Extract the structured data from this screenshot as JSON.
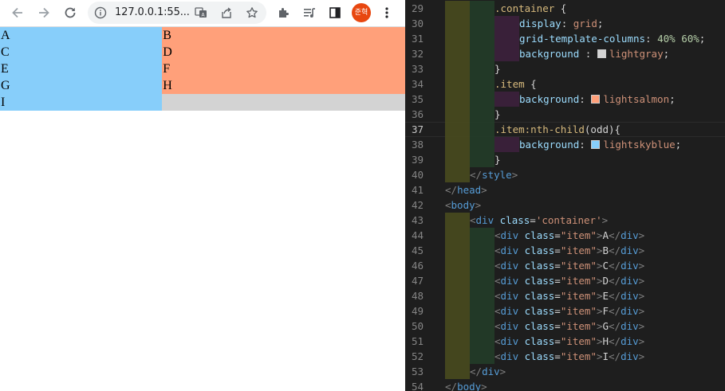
{
  "browser": {
    "url": "127.0.0.1:55...",
    "avatar_text": "준혁",
    "grid_items": [
      "A",
      "B",
      "C",
      "D",
      "E",
      "F",
      "G",
      "H",
      "I"
    ]
  },
  "editor": {
    "lines": [
      {
        "n": "29",
        "indent": 2,
        "text": ".container {",
        "kind": "selector"
      },
      {
        "n": "30",
        "indent": 3,
        "prop": "display",
        "val": "grid"
      },
      {
        "n": "31",
        "indent": 3,
        "prop": "grid-template-columns",
        "val": "40% 60%",
        "valkind": "num"
      },
      {
        "n": "32",
        "indent": 3,
        "prop": "background ",
        "val": "lightgray",
        "swatch": "#d3d3d3"
      },
      {
        "n": "33",
        "indent": 2,
        "text": "}",
        "kind": "punct"
      },
      {
        "n": "34",
        "indent": 2,
        "text": ".item {",
        "kind": "selector"
      },
      {
        "n": "35",
        "indent": 3,
        "prop": "background",
        "val": "lightsalmon",
        "swatch": "#ffa07a"
      },
      {
        "n": "36",
        "indent": 2,
        "text": "}",
        "kind": "punct"
      },
      {
        "n": "37",
        "indent": 2,
        "text": ".item:nth-child(odd){",
        "kind": "nth",
        "current": true
      },
      {
        "n": "38",
        "indent": 3,
        "prop": "background",
        "val": "lightskyblue",
        "swatch": "#87cefa"
      },
      {
        "n": "39",
        "indent": 2,
        "text": "}",
        "kind": "punct"
      },
      {
        "n": "40",
        "indent": 1,
        "tag": "/style"
      },
      {
        "n": "41",
        "indent": 0,
        "tag": "/head"
      },
      {
        "n": "42",
        "indent": 0,
        "tag": "body"
      },
      {
        "n": "43",
        "indent": 1,
        "tag": "div",
        "attr": "class",
        "attrval": "'container'"
      },
      {
        "n": "44",
        "indent": 2,
        "tag": "div",
        "attr": "class",
        "attrval": "\"item\"",
        "inner": "A"
      },
      {
        "n": "45",
        "indent": 2,
        "tag": "div",
        "attr": "class",
        "attrval": "\"item\"",
        "inner": "B"
      },
      {
        "n": "46",
        "indent": 2,
        "tag": "div",
        "attr": "class",
        "attrval": "\"item\"",
        "inner": "C"
      },
      {
        "n": "47",
        "indent": 2,
        "tag": "div",
        "attr": "class",
        "attrval": "\"item\"",
        "inner": "D"
      },
      {
        "n": "48",
        "indent": 2,
        "tag": "div",
        "attr": "class",
        "attrval": "\"item\"",
        "inner": "E"
      },
      {
        "n": "49",
        "indent": 2,
        "tag": "div",
        "attr": "class",
        "attrval": "\"item\"",
        "inner": "F"
      },
      {
        "n": "50",
        "indent": 2,
        "tag": "div",
        "attr": "class",
        "attrval": "\"item\"",
        "inner": "G"
      },
      {
        "n": "51",
        "indent": 2,
        "tag": "div",
        "attr": "class",
        "attrval": "\"item\"",
        "inner": "H"
      },
      {
        "n": "52",
        "indent": 2,
        "tag": "div",
        "attr": "class",
        "attrval": "\"item\"",
        "inner": "I"
      },
      {
        "n": "53",
        "indent": 1,
        "tag": "/div"
      },
      {
        "n": "54",
        "indent": 0,
        "tag": "/body"
      }
    ]
  },
  "colors": {
    "editor_bg": "#1e1e1e",
    "avatar_bg": "#e8470f",
    "lightskyblue": "#87cefa",
    "lightsalmon": "#ffa07a",
    "lightgray": "#d3d3d3"
  },
  "icons": {
    "toolbar": [
      "back-arrow-icon",
      "forward-arrow-icon",
      "reload-icon",
      "info-icon",
      "translate-icon",
      "share-icon",
      "bookmark-star-icon",
      "extensions-puzzle-icon",
      "media-queue-icon",
      "side-panel-icon",
      "more-vert-icon"
    ]
  }
}
